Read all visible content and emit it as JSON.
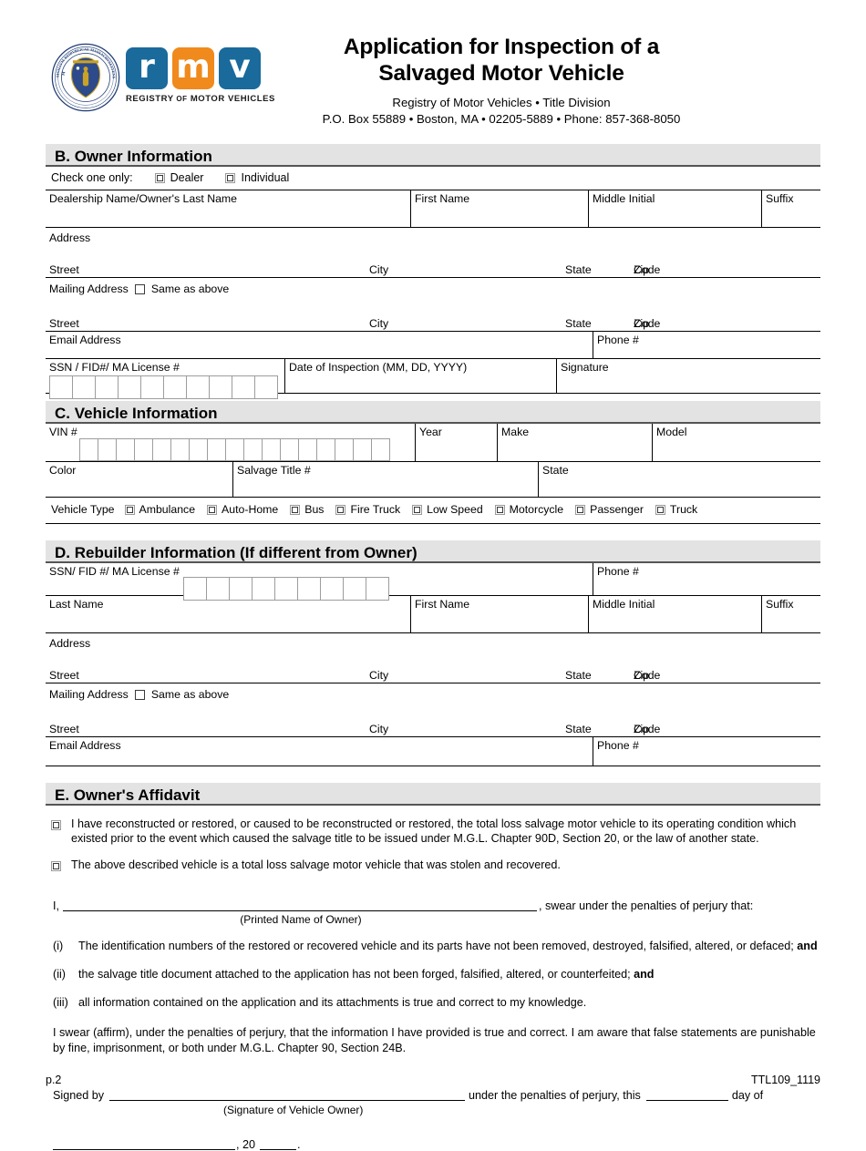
{
  "header": {
    "seal_alt": "massachusetts-state-seal",
    "logo_letters": [
      "r",
      "m",
      "v"
    ],
    "logo_caption_1": "REGISTRY",
    "logo_caption_2": "OF",
    "logo_caption_3": "MOTOR VEHICLES",
    "title_line1": "Application for Inspection of a",
    "title_line2": "Salvaged Motor Vehicle",
    "sub_line1": "Registry of Motor Vehicles • Title Division",
    "sub_line2": "P.O. Box 55889 • Boston, MA • 02205-5889 • Phone: 857-368-8050",
    "brand_blue": "#1a6a9c",
    "brand_orange": "#f08a1c"
  },
  "section_b": {
    "heading": "B. Owner Information",
    "check_one_label": "Check one only:",
    "option_dealer": "Dealer",
    "option_individual": "Individual",
    "name_row": {
      "dealership": "Dealership Name/Owner's Last Name",
      "first_name": "First Name",
      "middle_initial": "Middle Initial",
      "suffix": "Suffix"
    },
    "address_label": "Address",
    "street": "Street",
    "city": "City",
    "state": "State",
    "zip_line1": "Zip",
    "zip_line2": "Code",
    "mailing_address_label": "Mailing Address",
    "same_as_above": "Same as above",
    "email_address": "Email Address",
    "phone": "Phone #",
    "ssn_label": "SSN / FID#/ MA License #",
    "ssn_box_count": 10,
    "date_of_inspection": "Date of Inspection (MM, DD, YYYY)",
    "signature": "Signature"
  },
  "section_c": {
    "heading": "C. Vehicle Information",
    "vin_label": "VIN #",
    "vin_box_count": 17,
    "year": "Year",
    "make": "Make",
    "model": "Model",
    "color": "Color",
    "salvage_title": "Salvage Title #",
    "state": "State",
    "vehicle_type_label": "Vehicle Type",
    "vehicle_types": [
      "Ambulance",
      "Auto-Home",
      "Bus",
      "Fire Truck",
      "Low Speed",
      "Motorcycle",
      "Passenger",
      "Truck"
    ]
  },
  "section_d": {
    "heading": "D. Rebuilder Information (If different from Owner)",
    "ssn_label": "SSN/ FID #/ MA License #",
    "ssn_box_count": 9,
    "phone": "Phone #",
    "last_name": "Last Name",
    "first_name": "First Name",
    "middle_initial": "Middle Initial",
    "suffix": "Suffix",
    "address_label": "Address",
    "street": "Street",
    "city": "City",
    "state": "State",
    "zip_line1": "Zip",
    "zip_line2": "Code",
    "mailing_address_label": "Mailing Address",
    "same_as_above": "Same as above",
    "email_address": "Email Address",
    "phone2": "Phone #"
  },
  "section_e": {
    "heading": "E. Owner's Affidavit",
    "affidavit_1": "I have reconstructed or restored, or caused to be reconstructed or restored, the total loss salvage motor vehicle to its operating condition which existed prior to the event which caused the salvage title to be issued under M.G.L. Chapter 90D, Section 20, or the law of another state.",
    "affidavit_2": "The above described vehicle is a total loss salvage motor vehicle that was stolen and recovered.",
    "i_prefix": "I,",
    "swear_suffix": ", swear under the penalties of perjury that:",
    "printed_name_caption": "(Printed Name of Owner)",
    "item_i_num": "(i)",
    "item_i_text_a": "The identification numbers of the restored or recovered vehicle and its parts have not been removed, destroyed, falsified, altered, or defaced; ",
    "item_i_bold": "and",
    "item_ii_num": "(ii)",
    "item_ii_text_a": "the salvage title document attached to the application has not been forged, falsified, altered, or counterfeited; ",
    "item_ii_bold": "and",
    "item_iii_num": "(iii)",
    "item_iii_text": "all information contained on the application and its attachments is true and correct to my knowledge.",
    "swear_paragraph": "I swear (affirm), under the penalties of perjury, that the information I have provided is true and correct. I am aware that false statements are punishable by fine, imprisonment, or both under M.G.L. Chapter 90, Section 24B.",
    "signed_by": "Signed by",
    "signature_caption": "(Signature of Vehicle Owner)",
    "under_penalties": "under the penalties of perjury, this",
    "day_of": "day of",
    "year_prefix": ", 20",
    "year_suffix": "."
  },
  "footer": {
    "page": "p.2",
    "form_id": "TTL109_1119"
  }
}
